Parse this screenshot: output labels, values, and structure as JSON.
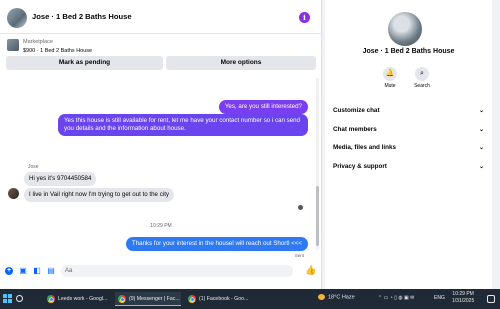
{
  "chat": {
    "title": "Jose · 1 Bed 2 Baths House",
    "info_icon": "info-icon",
    "marketplace": {
      "label": "Marketplace",
      "price_title": "$900 · 1 Bed 2 Baths House",
      "mark_pending": "Mark as pending",
      "more_options": "More options"
    },
    "messages": {
      "out1": "Yes, are you still interested?",
      "out2": "Yes this house is still available for rent, let me have your contact number so i can send you details and the information about house.",
      "sender_name": "Jose",
      "in1": "Hi yes it's 9704450584",
      "in2": "I live in Vail right now I'm trying to get out to the city",
      "timestamp": "10:29 PM",
      "out3": "Thanks for your interest in the housel will reach out Shortl <<<",
      "status": "Sent"
    },
    "composer": {
      "value": "Aa"
    }
  },
  "side": {
    "title": "Jose · 1 Bed 2 Baths House",
    "mute_label": "Mute",
    "search_label": "Search",
    "sections": [
      "Customize chat",
      "Chat members",
      "Media, files and links",
      "Privacy & support"
    ]
  },
  "taskbar": {
    "apps": [
      {
        "label": "Leeds work - Googl..."
      },
      {
        "label": "(9) Messenger | Fac..."
      },
      {
        "label": "(1) Facebook - Goo..."
      }
    ],
    "weather": "18°C  Haze",
    "lang": "ENG",
    "time": "10:29 PM",
    "date": "1/31/2025"
  },
  "colors": {
    "accent": "#0866ff",
    "info": "#8b2ee6"
  }
}
